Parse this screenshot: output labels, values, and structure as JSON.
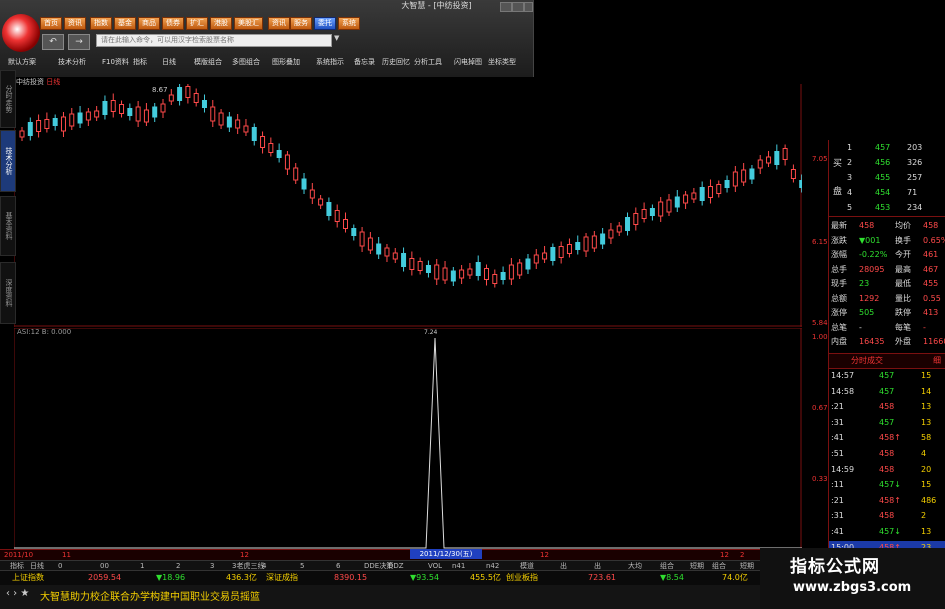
{
  "window": {
    "title": "大智慧 - [中纺投资]"
  },
  "toolbar": {
    "buttons": [
      "首页",
      "资讯",
      "指数",
      "基金",
      "商品",
      "债券",
      "扩汇",
      "港股",
      "美股汇",
      "资讯",
      "服务",
      "委托",
      "系统"
    ],
    "command_placeholder": "请在此输入命令，可以用汉字检索股票名称",
    "menu": [
      "默认方案",
      "技术分析",
      "F10资料",
      "指标",
      "日线",
      "模版组合",
      "多图组合",
      "图形叠加",
      "系统指示",
      "备忘录",
      "历史回忆",
      "分析工具",
      "闪电掉图",
      "坐标类型"
    ]
  },
  "side_tabs": [
    "分时走势",
    "技术分析",
    "基本资料",
    "深度资料"
  ],
  "stock": {
    "name": "中纺投资",
    "period": "日线"
  },
  "indicator": {
    "label": "ASI:12  B: 0.000"
  },
  "kline_labels": {
    "high": "8.67",
    "low": "?",
    "peak_label": "7.24"
  },
  "price_axis": [
    "7.05",
    "6.15",
    "5.84"
  ],
  "indicator_axis": [
    "1.00",
    "0.67",
    "0.33"
  ],
  "order_book": {
    "sell": [
      {
        "lv": "1",
        "price": "457",
        "vol": "203"
      },
      {
        "lv": "2",
        "price": "456",
        "vol": "326"
      },
      {
        "lv": "3",
        "price": "455",
        "vol": "257"
      },
      {
        "lv": "4",
        "price": "454",
        "vol": "71"
      },
      {
        "lv": "5",
        "price": "453",
        "vol": "234"
      }
    ],
    "buy_label": "买",
    "sell_label": "盘"
  },
  "quote": [
    {
      "l": "最新",
      "v": "458",
      "l2": "均价",
      "v2": "458"
    },
    {
      "l": "涨跌",
      "v": "▼001",
      "l2": "换手",
      "v2": "0.65%"
    },
    {
      "l": "涨幅",
      "v": "-0.22%",
      "l2": "今开",
      "v2": "461"
    },
    {
      "l": "总手",
      "v": "28095",
      "l2": "最高",
      "v2": "467"
    },
    {
      "l": "现手",
      "v": "23",
      "l2": "最低",
      "v2": "455"
    },
    {
      "l": "总额",
      "v": "1292",
      "l2": "量比",
      "v2": "0.55"
    },
    {
      "l": "涨停",
      "v": "505",
      "l2": "跌停",
      "v2": "413"
    },
    {
      "l": "总笔",
      "v": "-",
      "l2": "每笔",
      "v2": "-"
    },
    {
      "l": "内盘",
      "v": "16435",
      "l2": "外盘",
      "v2": "11660"
    }
  ],
  "ticks_header": {
    "title": "分时成交",
    "col": "细"
  },
  "ticks": [
    {
      "t": "14:57",
      "p": "457",
      "v": "15"
    },
    {
      "t": "14:58",
      "p": "457",
      "v": "14"
    },
    {
      "t": ":21",
      "p": "458",
      "v": "13"
    },
    {
      "t": ":31",
      "p": "457",
      "v": "13"
    },
    {
      "t": ":41",
      "p": "458↑",
      "v": "58"
    },
    {
      "t": ":51",
      "p": "458",
      "v": "4"
    },
    {
      "t": "14:59",
      "p": "458",
      "v": "20"
    },
    {
      "t": ":11",
      "p": "457↓",
      "v": "15"
    },
    {
      "t": ":21",
      "p": "458↑",
      "v": "486"
    },
    {
      "t": ":31",
      "p": "458",
      "v": "2"
    },
    {
      "t": ":41",
      "p": "457↓",
      "v": "13"
    },
    {
      "t": "15:00",
      "p": "458↑",
      "v": "23"
    }
  ],
  "date_axis": [
    "2011/10",
    "11",
    "12",
    "12",
    "12",
    "2"
  ],
  "date_cursor": "2011/12/30(五)",
  "strip_tabs": [
    "指标",
    "日线",
    "0",
    "00",
    "1",
    "2",
    "3",
    "3老虎三线",
    "4",
    "5",
    "6",
    "DDE决策",
    "DDZ",
    "VOL",
    "n41",
    "n42",
    "模道",
    "出",
    "出",
    "大均",
    "组合",
    "短期",
    "组合",
    "短期"
  ],
  "index_bar": {
    "sh_name": "上证指数",
    "sh_val": "2059.54",
    "sh_chg": "▼18.96",
    "sh_amt": "436.3亿",
    "sz_name": "深证成指",
    "sz_val": "8390.15",
    "sz_chg": "▼93.54",
    "sz_amt": "455.5亿",
    "cy_name": "创业板指",
    "cy_val": "723.61",
    "cy_chg": "▼8.54",
    "cy_amt": "74.0亿"
  },
  "news": "大智慧助力校企联合办学构建中国职业交易员摇篮",
  "watermark": {
    "title": "指标公式网",
    "url": "www.zbgs3.com"
  }
}
